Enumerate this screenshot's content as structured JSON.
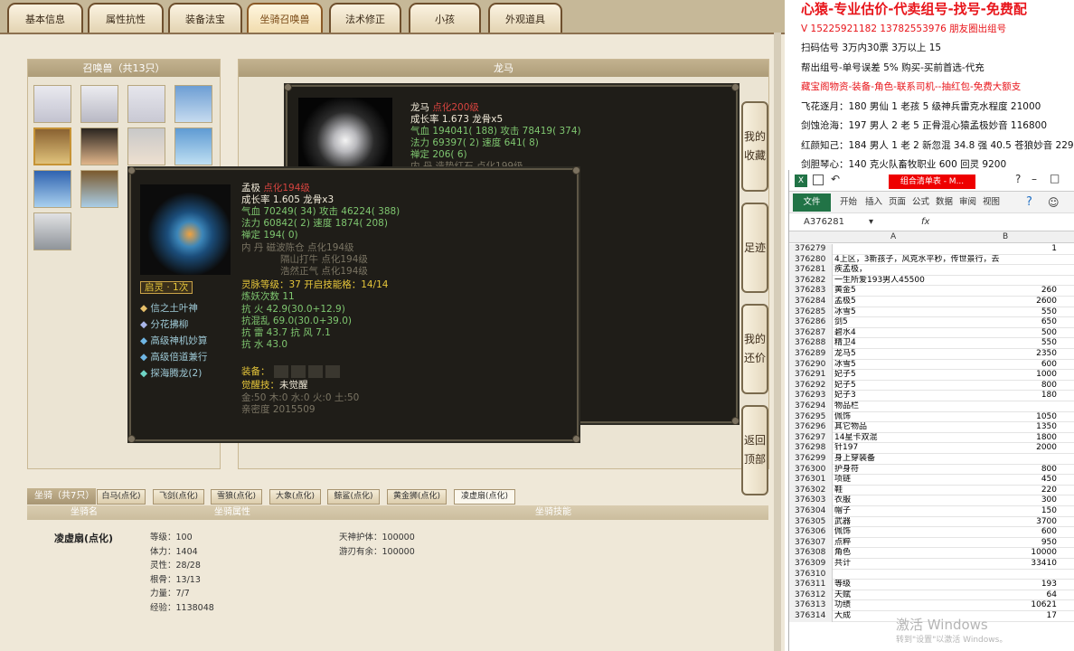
{
  "game": {
    "tabs": [
      "基本信息",
      "属性抗性",
      "装备法宝",
      "坐骑召唤兽",
      "法术修正",
      "小孩",
      "外观道具"
    ],
    "pet_list": {
      "header": "召唤兽（共13只）"
    },
    "pet_panel": {
      "header": "龙马"
    },
    "dlg1": {
      "name": "龙马",
      "tag": "点化200级",
      "line1": "成长率 1.673 龙骨x5",
      "line2": "气血 194041( 188) 攻击 78419( 374)",
      "line3": "法力 69397( 2) 速度 641( 8)",
      "line4": "禅定 206( 6)",
      "line5": "内  丹 造势红石  点化199级"
    },
    "dlg2": {
      "name": "孟极",
      "tag": "点化194级",
      "line1": "成长率 1.605 龙骨x3",
      "line2": "气血 70249( 34) 攻击 46224( 388)",
      "line3": "法力 60842( 2) 速度 1874( 208)",
      "line4": "禅定 194( 0)",
      "nd1": "内   丹  磁波陈仓  点化194级",
      "nd2": "隔山打牛  点化194级",
      "nd3": "浩然正气  点化194级",
      "ling": "灵脉等级：37  开启技能格：14/14",
      "lian": "炼妖次数 11",
      "k1": "抗   火  42.9(30.0+12.9)",
      "k2": "抗混乱  69.0(30.0+39.0)",
      "k3": "抗   雷  43.7 抗   风  7.1",
      "k4": "抗   水  43.0",
      "qiling": "启灵 · 1次",
      "skills": [
        "信之土叶神",
        "分花拂柳",
        "高级神机妙算",
        "高级倍道兼行",
        "探海腾龙(2)"
      ],
      "equip": "装备：",
      "jx_label": "觉醒技：",
      "jx_val": "未觉醒",
      "wx": "金:50 木:0 水:0 火:0 土:50",
      "qm": "亲密度 2015509"
    },
    "side_buttons": [
      "我的收藏",
      "足迹",
      "我的还价",
      "返回顶部"
    ],
    "mount": {
      "tab_title": "坐骑（共7只）",
      "tabs": [
        "白马(点化)",
        "飞剑(点化)",
        "雪狼(点化)",
        "大象(点化)",
        "鲸鲨(点化)",
        "黄金狮(点化)",
        "凌虚扇(点化)"
      ],
      "col1": "坐骑名",
      "col2": "坐骑属性",
      "col3": "坐骑技能",
      "name": "凌虚扇(点化)",
      "attrs": [
        "等级：100",
        "体力：1404",
        "灵性：28/28",
        "根骨：13/13",
        "力量：7/7",
        "经验：1138048"
      ],
      "skills": [
        "天神护体：100000",
        "游刃有余：100000"
      ]
    }
  },
  "ad": {
    "l1": "心猿-专业估价-代卖组号-找号-免费配",
    "l2": "V 15225921182  13782553976 朋友圈出组号",
    "l3": "扫码估号 3万内30票  3万以上 15",
    "l4": "帮出组号-单号误差 5%  购买-买前首选-代充",
    "l5": "藏宝阁物资-装备-角色-联系司机--抽红包-免费大额支",
    "l6": "飞花逐月：180 男仙 1 老孩 5 级神兵雷克水程度 21000",
    "l7": "剑蚀沧海：197 男人 2 老 5 正骨混心猿孟极妙音 116800",
    "l8": "红颜知己：184 男人 1 老 2 新忽混 34.8 强 40.5 苍狼妙音 229",
    "l9": "剑胆琴心：140 克火队畜牧职业 600 回灵 9200"
  },
  "excel": {
    "title": "组合清单表 - M...",
    "ribbon": [
      "文件",
      "开始",
      "插入",
      "页面",
      "公式",
      "数据",
      "审阅",
      "视图"
    ],
    "namebox": "A376281",
    "fx": "fx",
    "cols": [
      "A",
      "B"
    ],
    "watermark1": "激活 Windows",
    "watermark2": "转到\"设置\"以激活 Windows。",
    "rows": [
      [
        "376279",
        "",
        "1"
      ],
      [
        "376280",
        "4上区，3新孩子，风克水平秒，传世景行，去疾孟极，",
        ""
      ],
      [
        "376281",
        "",
        ""
      ],
      [
        "376282",
        "一生所爱193男人45500",
        ""
      ],
      [
        "376283",
        "黄金5",
        "260"
      ],
      [
        "376284",
        "孟极5",
        "2600"
      ],
      [
        "376285",
        "冰雪5",
        "550"
      ],
      [
        "376286",
        "剑5",
        "650"
      ],
      [
        "376287",
        "碧水4",
        "500"
      ],
      [
        "376288",
        "精卫4",
        "550"
      ],
      [
        "376289",
        "龙马5",
        "2350"
      ],
      [
        "376290",
        "冰雪5",
        "600"
      ],
      [
        "376291",
        "妃子5",
        "1000"
      ],
      [
        "376292",
        "妃子5",
        "800"
      ],
      [
        "376293",
        "妃子3",
        "180"
      ],
      [
        "376294",
        "物品栏",
        ""
      ],
      [
        "376295",
        "佩饰",
        "1050"
      ],
      [
        "376296",
        "其它物品",
        "1350"
      ],
      [
        "376297",
        "14星卡双混",
        "1800"
      ],
      [
        "376298",
        "针197",
        "2000"
      ],
      [
        "376299",
        "身上穿装备",
        ""
      ],
      [
        "376300",
        "护身符",
        "800"
      ],
      [
        "376301",
        "项链",
        "450"
      ],
      [
        "376302",
        "鞋",
        "220"
      ],
      [
        "376303",
        "衣服",
        "300"
      ],
      [
        "376304",
        "帽子",
        "150"
      ],
      [
        "376305",
        "武器",
        "3700"
      ],
      [
        "376306",
        "佩饰",
        "600"
      ],
      [
        "376307",
        "点粹",
        "950"
      ],
      [
        "376308",
        "角色",
        "10000"
      ],
      [
        "376309",
        "共计",
        "33410"
      ],
      [
        "376310",
        "",
        ""
      ],
      [
        "376311",
        "等级",
        "193"
      ],
      [
        "376312",
        "天赋",
        "64"
      ],
      [
        "376313",
        "功绩",
        "10621"
      ],
      [
        "376314",
        "大成",
        "17"
      ]
    ]
  }
}
